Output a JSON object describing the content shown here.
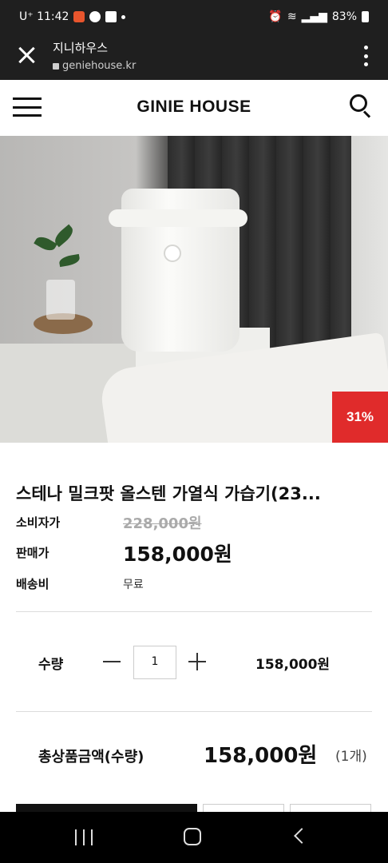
{
  "status_bar": {
    "carrier_time": "U⁺ 11:42",
    "battery": "83%"
  },
  "browser": {
    "site_name": "지니하우스",
    "url": "geniehouse.kr"
  },
  "header": {
    "logo": "GINIE HOUSE"
  },
  "product": {
    "discount_badge": "31%",
    "title": "스테나 밀크팟 올스텐 가열식 가습기(23...",
    "consumer_price_label": "소비자가",
    "consumer_price": "228,000원",
    "sale_price_label": "판매가",
    "sale_price": "158,000원",
    "shipping_label": "배송비",
    "shipping_value": "무료"
  },
  "quantity": {
    "label": "수량",
    "value": "1",
    "line_price": "158,000원"
  },
  "total": {
    "label": "총상품금액(수량)",
    "price": "158,000원",
    "count": "(1개)"
  },
  "colors": {
    "badge": "#e02b2b",
    "buy_button": "#111111"
  }
}
